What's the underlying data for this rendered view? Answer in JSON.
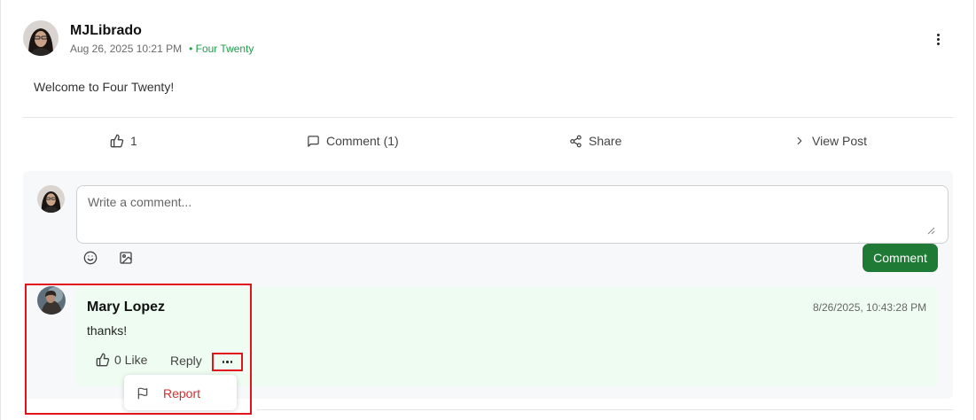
{
  "post": {
    "author": "MJLibrado",
    "date": "Aug 26, 2025 10:21 PM",
    "community": "• Four Twenty",
    "content": "Welcome to Four Twenty!",
    "actions": {
      "like_count": "1",
      "comment_label": "Comment (1)",
      "share_label": "Share",
      "view_label": "View Post"
    }
  },
  "composer": {
    "placeholder": "Write a comment...",
    "submit_label": "Comment"
  },
  "reply": {
    "author": "Mary Lopez",
    "timestamp": "8/26/2025, 10:43:28 PM",
    "text": "thanks!",
    "like_label": "0 Like",
    "reply_label": "Reply"
  },
  "menu": {
    "report_label": "Report"
  },
  "icons": {
    "like": "thumbs-up-icon",
    "comment": "speech-bubble-icon",
    "share": "share-nodes-icon",
    "view": "chevron-right-icon",
    "emoji": "smiley-icon",
    "image": "image-icon",
    "more": "ellipsis-icon",
    "kebab": "vertical-dots-icon",
    "report": "flag-icon"
  },
  "colors": {
    "accent_green": "#1e7a34",
    "community_green": "#1f9d4a",
    "reply_background": "#effcf1",
    "report_red": "#d32f2f",
    "highlight_red": "#e0141a"
  }
}
